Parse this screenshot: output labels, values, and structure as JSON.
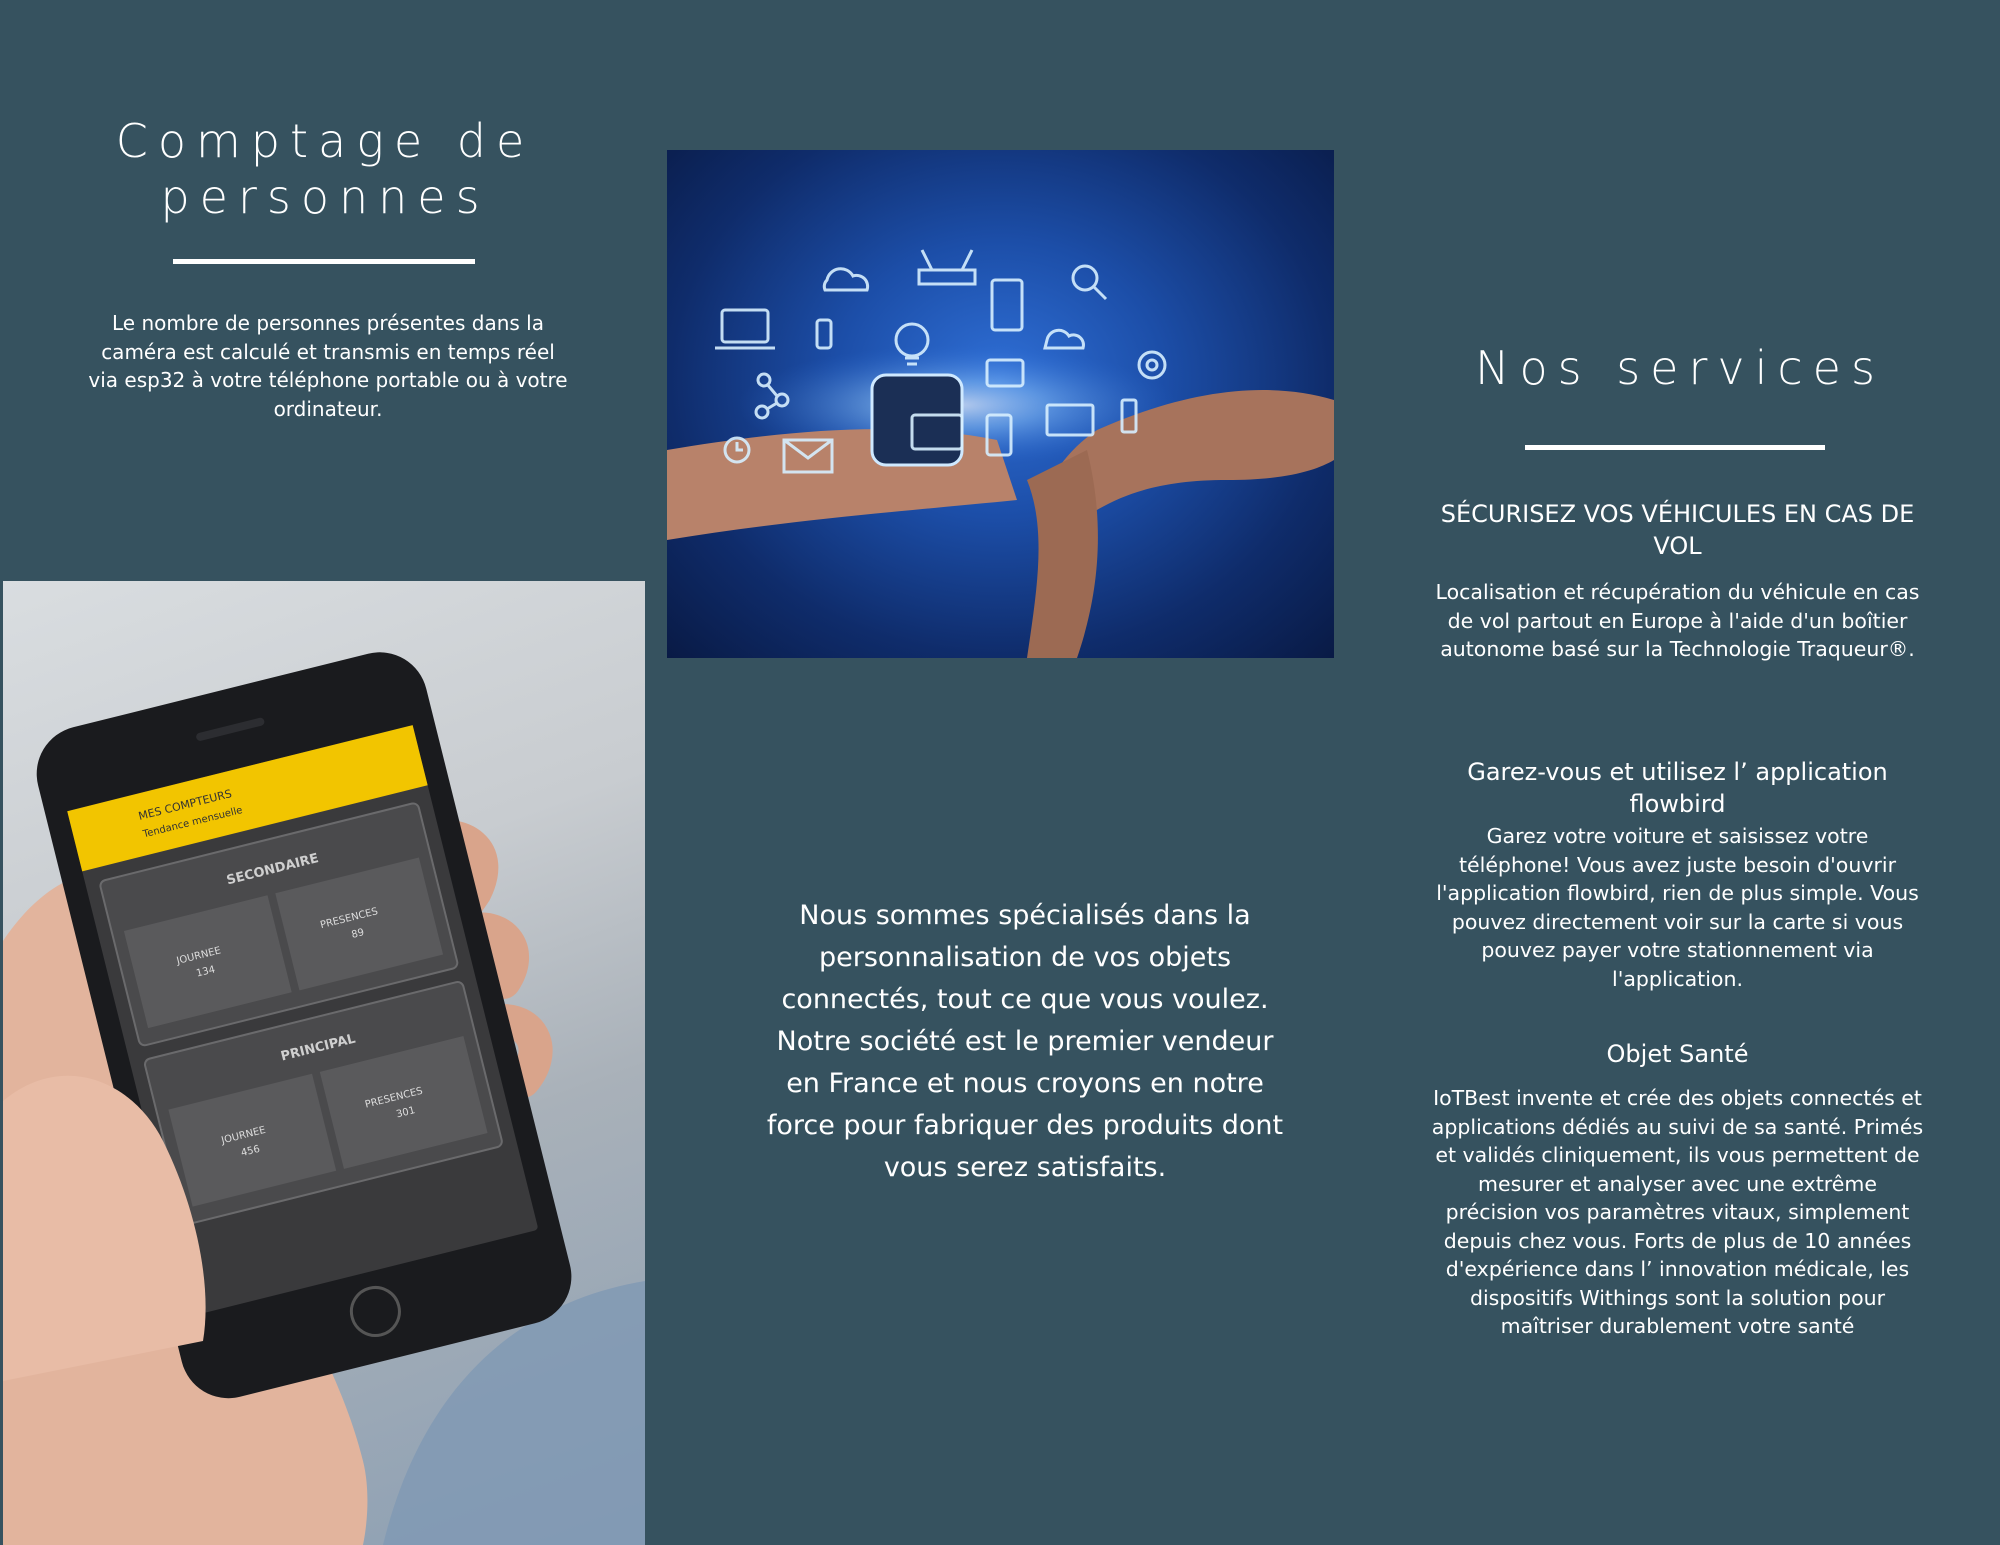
{
  "left": {
    "title": "Comptage de personnes",
    "text": "Le nombre de personnes présentes dans la caméra est calculé et transmis en temps réel via esp32 à votre téléphone portable ou à votre ordinateur."
  },
  "center": {
    "text": "Nous sommes spécialisés dans la personnalisation de vos objets connectés, tout ce que vous voulez. Notre société est le premier vendeur en France et nous croyons en notre force pour fabriquer des produits dont vous serez satisfaits."
  },
  "phone_app": {
    "header": "MES COMPTEURS",
    "sub": "Tendance mensuelle",
    "section1": "SECONDAIRE",
    "section2": "PRINCIPAL",
    "journee": "JOURNEE",
    "presences": "PRESENCES",
    "values": [
      "134",
      "89",
      "456",
      "301"
    ]
  },
  "right": {
    "title": "Nos services",
    "services": [
      {
        "heading": "SÉCURISEZ VOS VÉHICULES EN CAS DE VOL",
        "text": "Localisation et récupération du véhicule en cas de vol partout en Europe à l'aide d'un boîtier autonome basé sur la Technologie Traqueur®."
      },
      {
        "heading": "Garez-vous et utilisez l’ application flowbird",
        "text": "Garez votre voiture et saisissez votre téléphone! Vous avez juste besoin d'ouvrir l'application flowbird, rien de plus simple. Vous pouvez directement voir sur la carte si vous pouvez payer votre stationnement via l'application."
      },
      {
        "heading": "Objet Santé",
        "text": "IoTBest invente et crée des objets connectés et applications dédiés au suivi de sa santé. Primés et validés cliniquement, ils vous permettent de mesurer et analyser avec une extrême précision vos paramètres vitaux, simplement depuis chez vous. Forts de plus de 10 années d'expérience dans l’ innovation médicale, les dispositifs Withings sont la solution pour maîtriser durablement votre santé"
      }
    ]
  },
  "colors": {
    "background": "#36525f",
    "text": "#ffffff",
    "app_accent": "#f2c500"
  }
}
